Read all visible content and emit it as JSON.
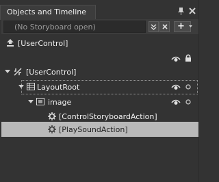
{
  "panel": {
    "title": "Objects and Timeline"
  },
  "storyboard": {
    "current": "(No Storyboard open)",
    "add_label": "+"
  },
  "scope": {
    "label": "[UserControl]"
  },
  "tree": {
    "root_label": "[UserControl]",
    "layoutroot_label": "LayoutRoot",
    "image_label": "image",
    "action1_label": "[ControlStoryboardAction]",
    "action2_label": "[PlaySoundAction]"
  },
  "colors": {
    "panel_bg": "#333333",
    "highlight": "#b9b9b9"
  }
}
